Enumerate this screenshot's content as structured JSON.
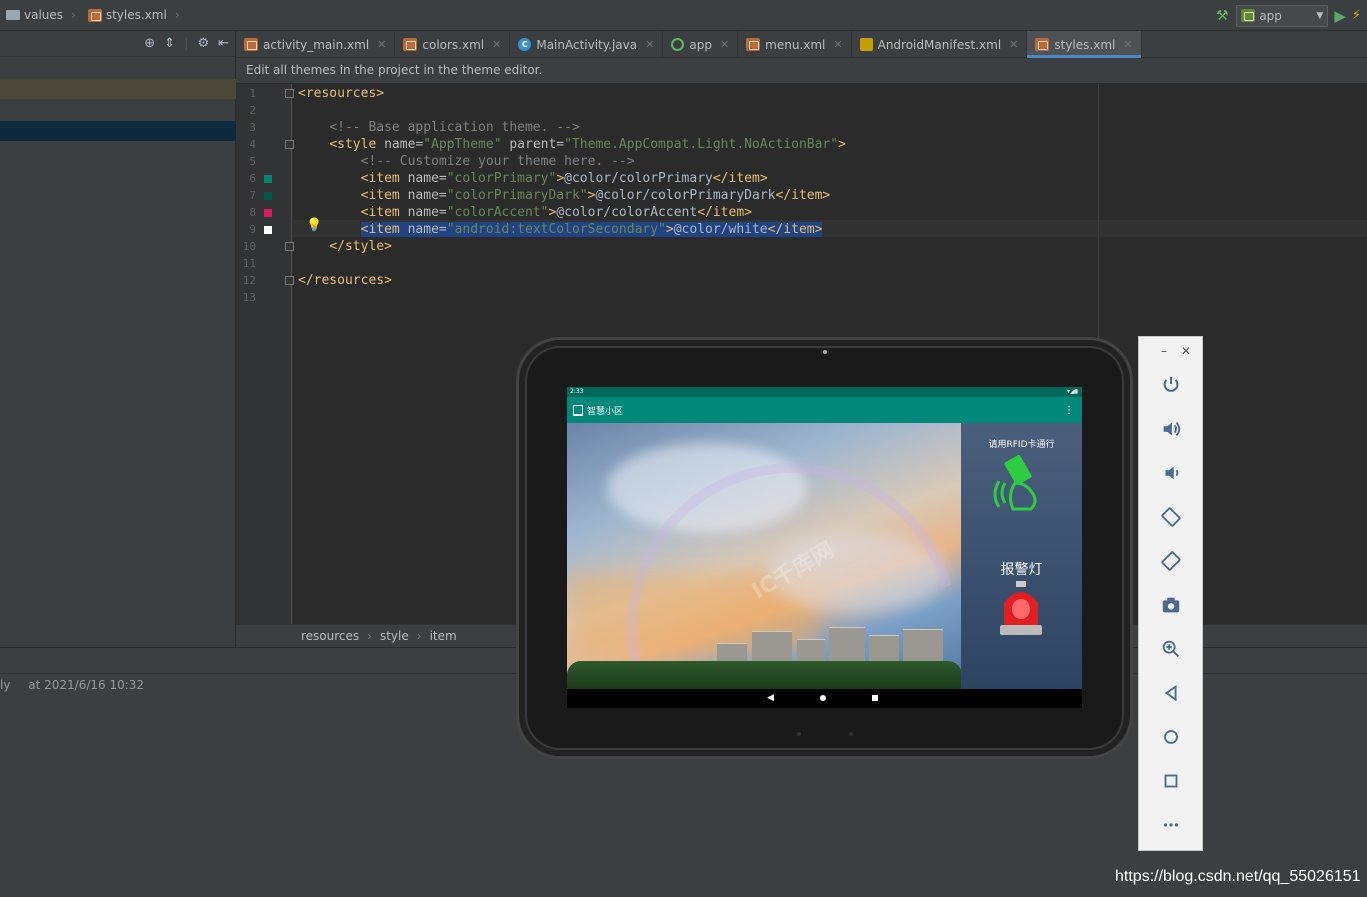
{
  "navbar": {
    "crumbs": [
      "values",
      "styles.xml"
    ],
    "run_config": "app"
  },
  "tabs": [
    {
      "label": "activity_main.xml",
      "icon": "xml-icon"
    },
    {
      "label": "colors.xml",
      "icon": "xml-icon"
    },
    {
      "label": "MainActivity.java",
      "icon": "java-class-icon"
    },
    {
      "label": "app",
      "icon": "app-module-icon"
    },
    {
      "label": "menu.xml",
      "icon": "xml-icon"
    },
    {
      "label": "AndroidManifest.xml",
      "icon": "manifest-icon"
    },
    {
      "label": "styles.xml",
      "icon": "xml-icon",
      "active": true
    }
  ],
  "banner": "Edit all themes in the project in the theme editor.",
  "code": {
    "line_numbers": [
      "1",
      "2",
      "3",
      "4",
      "5",
      "6",
      "7",
      "8",
      "9",
      "10",
      "11",
      "12",
      "13"
    ],
    "swatches": [
      "#008577",
      "#00574B",
      "#D81B60",
      "#FFFFFF"
    ]
  },
  "editor_breadcrumb": [
    "resources",
    "style",
    "item"
  ],
  "bottom": {
    "lead": "ly",
    "timestamp": "at 2021/6/16 10:32"
  },
  "emulator": {
    "status_time": "2:33",
    "app_title": "智慧小区",
    "rfid_label": "请用RFID卡通行",
    "alarm_label": "报警灯",
    "watermark": "IC千库网"
  },
  "footer_url": "https://blog.csdn.net/qq_55026151"
}
